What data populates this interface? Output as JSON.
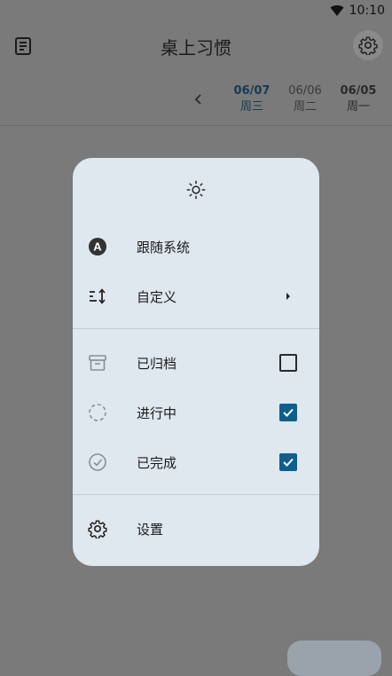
{
  "status": {
    "time": "10:10"
  },
  "appbar": {
    "title": "桌上习惯"
  },
  "dates": [
    {
      "date": "06/07",
      "weekday": "周三"
    },
    {
      "date": "06/06",
      "weekday": "周二"
    },
    {
      "date": "06/05",
      "weekday": "周一"
    }
  ],
  "menu": {
    "theme_follow_system": "跟随系统",
    "custom": "自定义",
    "archived": "已归档",
    "in_progress": "进行中",
    "completed": "已完成",
    "settings": "设置",
    "checks": {
      "archived": false,
      "in_progress": true,
      "completed": true
    }
  },
  "colors": {
    "accent": "#0f5e8c",
    "menu_bg": "#dfe7ef",
    "scrim": "#7a7a7a"
  }
}
